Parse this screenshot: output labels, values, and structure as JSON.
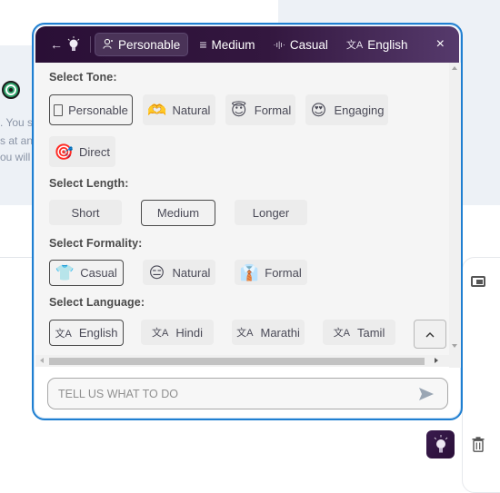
{
  "background": {
    "text_lines": [
      ". You s",
      "s at an",
      "ou will"
    ]
  },
  "header": {
    "back_icon": "arrow-left",
    "logo_icon": "lightbulb",
    "chips": [
      {
        "icon": "person-icon",
        "label": "Personable",
        "active": true
      },
      {
        "icon": "lines-icon",
        "label": "Medium",
        "active": false
      },
      {
        "icon": "waveform-icon",
        "label": "Casual",
        "active": false
      },
      {
        "icon": "translate-icon",
        "label": "English",
        "active": false
      }
    ],
    "close_icon": "×"
  },
  "tone": {
    "label": "Select Tone:",
    "options": [
      {
        "label": "Personable",
        "emoji": "",
        "selected": true
      },
      {
        "label": "Natural",
        "emoji": "🫶",
        "selected": false
      },
      {
        "label": "Formal",
        "emoji": "😇",
        "selected": false
      },
      {
        "label": "Engaging",
        "emoji": "😍",
        "selected": false
      },
      {
        "label": "Direct",
        "emoji": "🎯",
        "selected": false
      }
    ]
  },
  "length": {
    "label": "Select Length:",
    "options": [
      {
        "label": "Short",
        "selected": false
      },
      {
        "label": "Medium",
        "selected": true
      },
      {
        "label": "Longer",
        "selected": false
      }
    ]
  },
  "formality": {
    "label": "Select Formality:",
    "options": [
      {
        "label": "Casual",
        "emoji": "👕",
        "selected": true
      },
      {
        "label": "Natural",
        "emoji": "😑",
        "selected": false
      },
      {
        "label": "Formal",
        "emoji": "👔",
        "selected": false
      }
    ]
  },
  "language": {
    "label": "Select Language:",
    "options": [
      {
        "label": "English",
        "selected": true
      },
      {
        "label": "Hindi",
        "selected": false
      },
      {
        "label": "Marathi",
        "selected": false
      },
      {
        "label": "Tamil",
        "selected": false
      }
    ],
    "collapse_icon": "^"
  },
  "prompt": {
    "placeholder": "TELL US WHAT TO DO",
    "value": ""
  },
  "icons": {
    "translate": "文A",
    "lines": "≡",
    "wave": "·ı|ı·",
    "person": "ꕀ",
    "back": "←"
  },
  "colors": {
    "accent_border": "#1f7fd1",
    "header_dark": "#2a0f36",
    "header_light": "#563a6c"
  }
}
